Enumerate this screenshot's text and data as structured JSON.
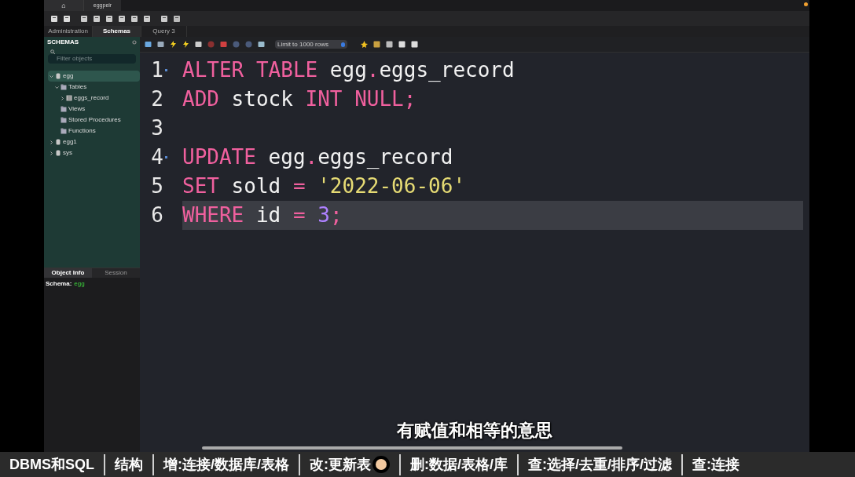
{
  "window": {
    "home_tab": "⌂",
    "connection_tab": "eggpeir"
  },
  "main_tabs": [
    {
      "label": "Administration",
      "selected": false
    },
    {
      "label": "Schemas",
      "selected": true
    },
    {
      "label": "Query 3",
      "selected": false
    }
  ],
  "sidebar": {
    "title": "SCHEMAS",
    "search_placeholder": "Filter objects",
    "tree": [
      {
        "label": "egg",
        "kind": "database",
        "expanded": true,
        "selected": true,
        "children": [
          {
            "label": "Tables",
            "kind": "folder",
            "expanded": true,
            "selected": false,
            "children": [
              {
                "label": "eggs_record",
                "kind": "table",
                "expanded": false,
                "selected": false
              }
            ]
          },
          {
            "label": "Views",
            "kind": "folder",
            "selected": false
          },
          {
            "label": "Stored Procedures",
            "kind": "folder",
            "selected": false
          },
          {
            "label": "Functions",
            "kind": "folder",
            "selected": false
          }
        ]
      },
      {
        "label": "egg1",
        "kind": "database",
        "expanded": false,
        "selected": false
      },
      {
        "label": "sys",
        "kind": "database",
        "expanded": false,
        "selected": false
      }
    ]
  },
  "info_tabs": [
    {
      "label": "Object Info",
      "selected": true
    },
    {
      "label": "Session",
      "selected": false
    }
  ],
  "info": {
    "label": "Schema:",
    "value": "egg"
  },
  "query_toolbar": {
    "limit": "Limit to 1000 rows"
  },
  "editor": {
    "lines": [
      {
        "number": "1",
        "fold": true,
        "highlighted": false,
        "tokens": [
          {
            "kind": "keyword",
            "text": "ALTER TABLE"
          },
          {
            "kind": "ident",
            "text": " egg"
          },
          {
            "kind": "op",
            "text": "."
          },
          {
            "kind": "ident",
            "text": "eggs_record"
          }
        ]
      },
      {
        "number": "2",
        "fold": false,
        "highlighted": false,
        "tokens": [
          {
            "kind": "keyword",
            "text": "ADD"
          },
          {
            "kind": "ident",
            "text": " stock "
          },
          {
            "kind": "keyword",
            "text": "INT NULL"
          },
          {
            "kind": "op",
            "text": ";"
          }
        ]
      },
      {
        "number": "3",
        "fold": false,
        "highlighted": false
      },
      {
        "number": "4",
        "fold": true,
        "highlighted": false,
        "tokens": [
          {
            "kind": "keyword",
            "text": "UPDATE"
          },
          {
            "kind": "ident",
            "text": " egg"
          },
          {
            "kind": "op",
            "text": "."
          },
          {
            "kind": "ident",
            "text": "eggs_record"
          }
        ]
      },
      {
        "number": "5",
        "fold": false,
        "highlighted": false,
        "tokens": [
          {
            "kind": "keyword",
            "text": "SET"
          },
          {
            "kind": "ident",
            "text": " sold "
          },
          {
            "kind": "op",
            "text": "="
          },
          {
            "kind": "string",
            "text": " '2022-06-06'"
          }
        ]
      },
      {
        "number": "6",
        "fold": false,
        "highlighted": true,
        "tokens": [
          {
            "kind": "keyword",
            "text": "WHERE"
          },
          {
            "kind": "ident",
            "text": " id "
          },
          {
            "kind": "op",
            "text": "="
          },
          {
            "kind": "number",
            "text": " 3"
          },
          {
            "kind": "op",
            "text": ";"
          }
        ]
      }
    ]
  },
  "subtitle": "有赋值和相等的意思",
  "chapters": [
    "DBMS和SQL",
    "结构",
    "增:连接/数据库/表格",
    "改:更新表",
    "删:数据/表格/库",
    "查:选择/去重/排序/过滤",
    "查:连接"
  ]
}
